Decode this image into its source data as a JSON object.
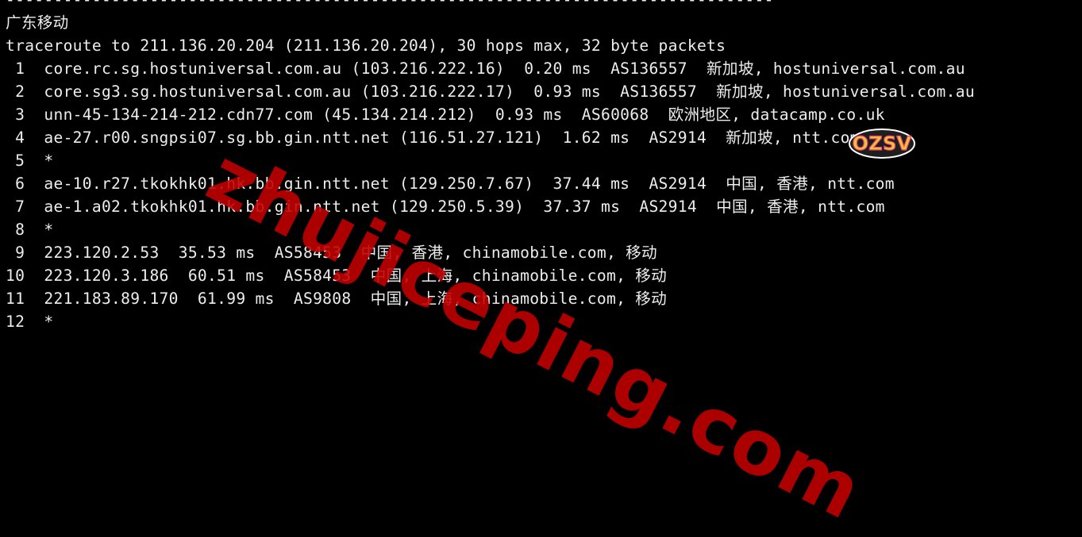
{
  "terminal": {
    "lines": [
      "--------------------------------------------------------------------------------",
      "广东移动",
      "traceroute to 211.136.20.204 (211.136.20.204), 30 hops max, 32 byte packets",
      " 1  core.rc.sg.hostuniversal.com.au (103.216.222.16)  0.20 ms  AS136557  新加坡, hostuniversal.com.au",
      " 2  core.sg3.sg.hostuniversal.com.au (103.216.222.17)  0.93 ms  AS136557  新加坡, hostuniversal.com.au",
      " 3  unn-45-134-214-212.cdn77.com (45.134.214.212)  0.93 ms  AS60068  欧洲地区, datacamp.co.uk",
      " 4  ae-27.r00.sngpsi07.sg.bb.gin.ntt.net (116.51.27.121)  1.62 ms  AS2914  新加坡, ntt.com",
      " 5  *",
      " 6  ae-10.r27.tkokhk01.hk.bb.gin.ntt.net (129.250.7.67)  37.44 ms  AS2914  中国, 香港, ntt.com",
      " 7  ae-1.a02.tkokhk01.hk.bb.gin.ntt.net (129.250.5.39)  37.37 ms  AS2914  中国, 香港, ntt.com",
      " 8  *",
      " 9  223.120.2.53  35.53 ms  AS58453  中国, 香港, chinamobile.com, 移动",
      "10  223.120.3.186  60.51 ms  AS58453  中国, 上海, chinamobile.com, 移动",
      "11  221.183.89.170  61.99 ms  AS9808  中国, 上海, chinamobile.com, 移动",
      "12  *"
    ]
  },
  "watermark": {
    "text": "zhujiceping.com",
    "color": "#c40000"
  },
  "logo": {
    "text": "OZSV",
    "colors": [
      "#f4c430",
      "#e8417a",
      "#3fa9f5"
    ]
  }
}
